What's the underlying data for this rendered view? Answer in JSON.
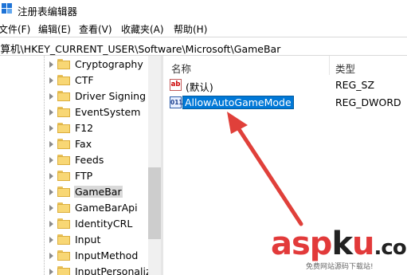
{
  "window": {
    "title": "注册表编辑器",
    "app_icon": "regedit-icon"
  },
  "menu": [
    {
      "label": "文件(F)"
    },
    {
      "label": "编辑(E)"
    },
    {
      "label": "查看(V)"
    },
    {
      "label": "收藏夹(A)"
    },
    {
      "label": "帮助(H)"
    }
  ],
  "address": {
    "path": "计算机\\HKEY_CURRENT_USER\\Software\\Microsoft\\GameBar"
  },
  "tree": {
    "items": [
      {
        "label": "Cryptography"
      },
      {
        "label": "CTF"
      },
      {
        "label": "Driver Signing"
      },
      {
        "label": "EventSystem"
      },
      {
        "label": "F12"
      },
      {
        "label": "Fax"
      },
      {
        "label": "Feeds"
      },
      {
        "label": "FTP"
      },
      {
        "label": "GameBar",
        "selected": true
      },
      {
        "label": "GameBarApi"
      },
      {
        "label": "IdentityCRL"
      },
      {
        "label": "Input"
      },
      {
        "label": "InputMethod"
      },
      {
        "label": "InputPersonaliza"
      }
    ]
  },
  "list": {
    "columns": {
      "name": "名称",
      "type": "类型"
    },
    "rows": [
      {
        "name": "(默认)",
        "type": "REG_SZ",
        "icon": "string-value-icon"
      },
      {
        "name": "AllowAutoGameMode",
        "type": "REG_DWORD",
        "icon": "dword-value-icon",
        "editing": true
      }
    ]
  },
  "watermark": {
    "text_red1": "asp",
    "text_black": "k",
    "text_red2": "u",
    "suffix": ".com",
    "subtitle": "免费网站源码下载站!"
  },
  "colors": {
    "selection": "#0078d7",
    "arrow": "#e0403a",
    "folder": "#f8d775"
  }
}
